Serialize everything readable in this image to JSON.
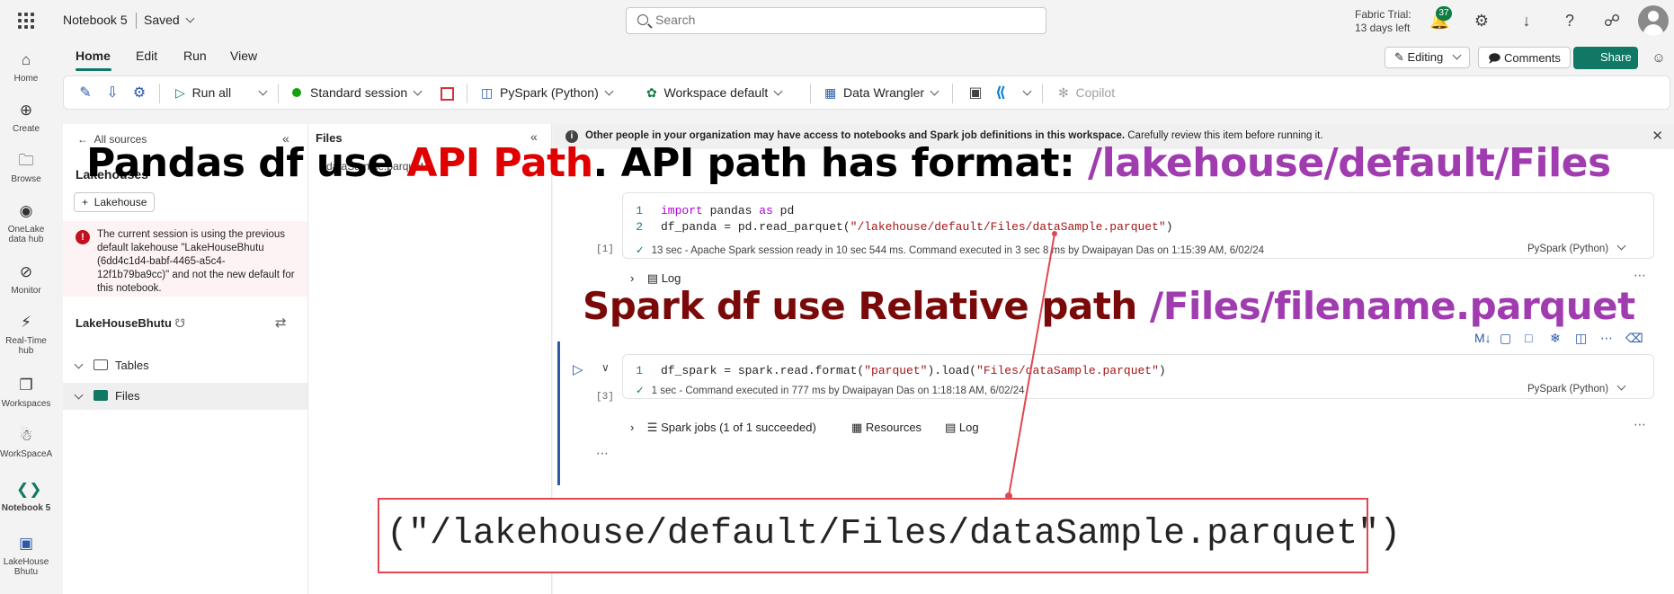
{
  "header": {
    "title": "Notebook 5",
    "status": "Saved",
    "search_placeholder": "Search",
    "trial_line1": "Fabric Trial:",
    "trial_line2": "13 days left",
    "notifications": "37"
  },
  "rail": [
    {
      "label": "Home",
      "icon": "home-icon"
    },
    {
      "label": "Create",
      "icon": "plus-icon"
    },
    {
      "label": "Browse",
      "icon": "folder-icon"
    },
    {
      "label": "OneLake data hub",
      "icon": "onelake-icon"
    },
    {
      "label": "Monitor",
      "icon": "monitor-icon"
    },
    {
      "label": "Real-Time hub",
      "icon": "realtime-icon"
    },
    {
      "label": "Workspaces",
      "icon": "workspaces-icon"
    },
    {
      "label": "WorkSpaceA",
      "icon": "workspace-icon"
    },
    {
      "label": "Notebook 5",
      "icon": "notebook-icon"
    },
    {
      "label": "LakeHouseBhutu",
      "icon": "lakehouse-icon"
    }
  ],
  "menu": [
    "Home",
    "Edit",
    "Run",
    "View"
  ],
  "toolbar": {
    "run_all": "Run all",
    "session": "Standard session",
    "language": "PySpark (Python)",
    "environment": "Workspace default",
    "data_wrangler": "Data Wrangler",
    "copilot": "Copilot"
  },
  "actions": {
    "editing": "Editing",
    "comments": "Comments",
    "share": "Share"
  },
  "explorer": {
    "back": "All sources",
    "heading": "Lakehouses",
    "add_button": "Lakehouse",
    "warning": "The current session is using the previous default lakehouse \"LakeHouseBhutu (6dd4c1d4-babf-4465-a5c4-12f1b79ba9cc)\" and not the new default for this notebook.",
    "lakehouse_name": "LakeHouseBhutu",
    "tree": [
      "Tables",
      "Files"
    ]
  },
  "files_panel": {
    "title": "Files",
    "entry": "dataSample.parquet"
  },
  "infobar": {
    "bold": "Other people in your organization may have access to notebooks and Spark job definitions in this workspace.",
    "rest": "Carefully review this item before running it."
  },
  "cell1": {
    "exec": "[1]",
    "line1_kw1": "import",
    "line1_mid": " pandas ",
    "line1_kw2": "as",
    "line1_end": " pd",
    "line2_code": "df_panda = pd.read_parquet(",
    "line2_str": "\"/lakehouse/default/Files/dataSample.parquet\"",
    "line2_end": ")",
    "status": "13 sec - Apache Spark session ready in 10 sec 544 ms. Command executed in 3 sec 8 ms by Dwaipayan Das on 1:15:39 AM, 6/02/24",
    "lang": "PySpark (Python)",
    "log": "Log"
  },
  "cell2": {
    "exec": "[3]",
    "code_a": "df_spark = spark.read.format(",
    "str_a": "\"parquet\"",
    "code_b": ").load(",
    "str_b": "\"Files/dataSample.parquet\"",
    "code_c": ")",
    "status": "1 sec - Command executed in 777 ms by Dwaipayan Das on 1:18:18 AM, 6/02/24",
    "lang": "PySpark (Python)",
    "spark_jobs": "Spark jobs (1 of 1 succeeded)",
    "resources": "Resources",
    "log": "Log"
  },
  "annotations": {
    "a1_part1": "Pandas df use ",
    "a1_red": "API Path",
    "a1_part2": ". API path has format: ",
    "a1_purple": "/lakehouse/default/Files",
    "a2_part1": "Spark df use Relative path ",
    "a2_purple": "/Files/filename.parquet",
    "zoom": "(\"/lakehouse/default/Files/dataSample.parquet\")"
  },
  "colors": {
    "accent": "#117865",
    "annotation_red": "#e00000",
    "annotation_purple": "#a03cb0",
    "annotation_darkred": "#7a0a0a"
  }
}
